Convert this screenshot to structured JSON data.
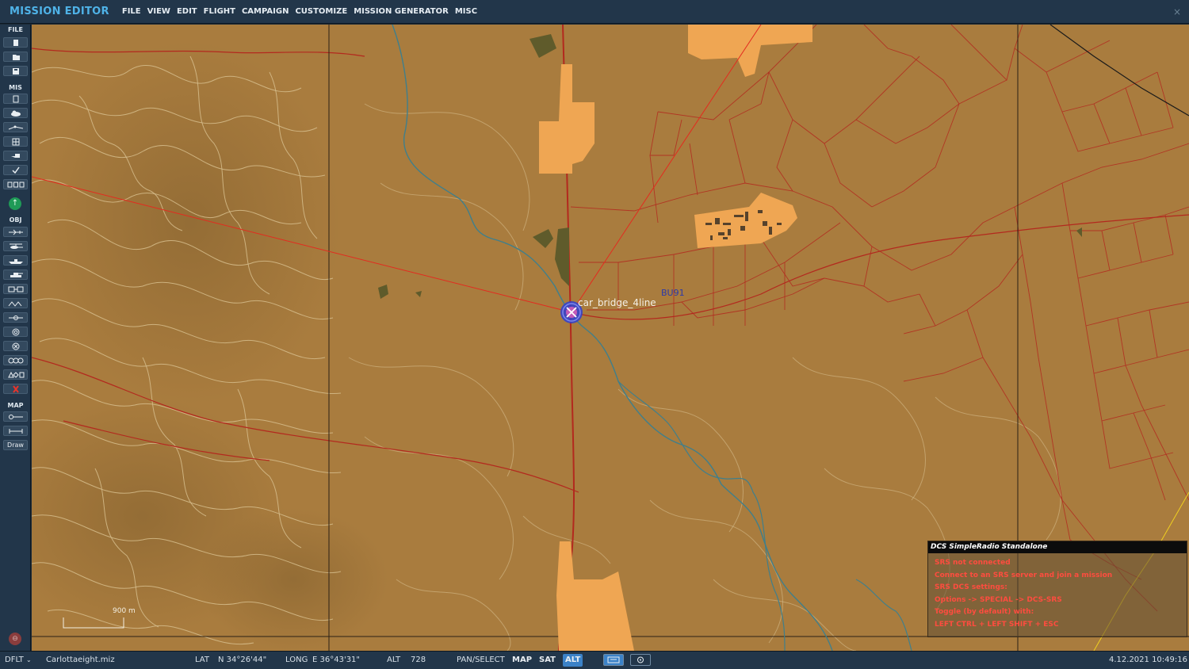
{
  "header": {
    "title": "MISSION EDITOR",
    "menu": [
      "FILE",
      "VIEW",
      "EDIT",
      "FLIGHT",
      "CAMPAIGN",
      "CUSTOMIZE",
      "MISSION GENERATOR",
      "MISC"
    ],
    "close_symbol": "×"
  },
  "sidebar": {
    "sections": {
      "file": "FILE",
      "mis": "MIS",
      "obj": "OBJ",
      "map": "MAP"
    },
    "draw_label": "Draw",
    "icons": {
      "file": [
        "new-file-icon",
        "open-folder-icon",
        "save-icon"
      ],
      "mis": [
        "briefing-icon",
        "weather-icon",
        "aircraft-route-icon",
        "trigger-zone-icon",
        "goals-flag-icon",
        "check-icon",
        "triggers-icon",
        "compass-icon"
      ],
      "obj": [
        "airplane-icon",
        "helicopter-icon",
        "ship-icon",
        "ground-unit-icon",
        "static-object-icon",
        "template-icon",
        "waypoint-icon",
        "target-icon",
        "zone-icon",
        "group-icon",
        "shapes-icon",
        "delete-icon"
      ],
      "map": [
        "ruler-icon",
        "measure-icon"
      ]
    }
  },
  "map": {
    "unit_label": "car_bridge_4line",
    "grid_label": "BU91",
    "scale_label": "900 m",
    "colors": {
      "terrain": "#a97c3e",
      "contour": "#d3b98a",
      "road": "#b3291e",
      "city": "#efa653",
      "river": "#3f7f8c",
      "route": "#e32b1f",
      "unit_marker": "#2f3fd1"
    }
  },
  "srs": {
    "title": "DCS SimpleRadio Standalone",
    "lines": [
      "SRS not connected",
      "Connect to an SRS server and join a mission",
      "SRS DCS settings:",
      "Options -> SPECIAL -> DCS-SRS",
      "Toggle (by default) with:",
      "LEFT CTRL + LEFT SHIFT + ESC"
    ]
  },
  "status": {
    "profile": "DFLT",
    "filename": "Carlottaeight.miz",
    "lat_label": "LAT",
    "lat_value": "N 34°26'44\"",
    "long_label": "LONG",
    "long_value": "E 36°43'31\"",
    "alt_label": "ALT",
    "alt_value": "728",
    "mode": "PAN/SELECT",
    "map_btn": "MAP",
    "sat_btn": "SAT",
    "alt_btn": "ALT",
    "datetime": "4.12.2021 10:49:16"
  }
}
